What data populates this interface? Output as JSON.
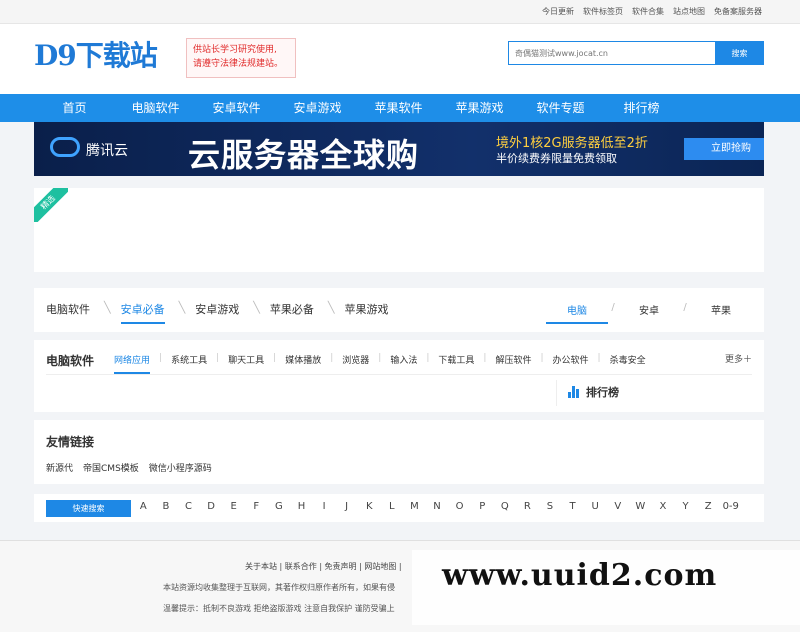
{
  "topbar": {
    "links": [
      "今日更新",
      "软件标签页",
      "软件合集",
      "站点地图",
      "免备案服务器"
    ]
  },
  "header": {
    "logo": "D9下载站",
    "notice_line1": "供站长学习研究使用,",
    "notice_line2": "请遵守法律法规建站。",
    "search_placeholder": "奇偶猫测试www.jocat.cn",
    "search_button": "搜索"
  },
  "nav": [
    "首页",
    "电脑软件",
    "安卓软件",
    "安卓游戏",
    "苹果软件",
    "苹果游戏",
    "软件专题",
    "排行榜"
  ],
  "banner": {
    "brand": "腾讯云",
    "headline": "云服务器全球购",
    "sub1": "境外1核2G服务器低至2折",
    "sub2": "半价续费券限量免费领取",
    "cta": "立即抢购"
  },
  "featured": {
    "ribbon": "精选"
  },
  "tabs": {
    "left": [
      "电脑软件",
      "安卓必备",
      "安卓游戏",
      "苹果必备",
      "苹果游戏"
    ],
    "active_left": "安卓必备",
    "right": [
      "电脑",
      "安卓",
      "苹果"
    ],
    "active_right": "电脑"
  },
  "software": {
    "title": "电脑软件",
    "categories": [
      "网络应用",
      "系统工具",
      "聊天工具",
      "媒体播放",
      "浏览器",
      "输入法",
      "下载工具",
      "解压软件",
      "办公软件",
      "杀毒安全"
    ],
    "active_category": "网络应用",
    "more": "更多＋",
    "rank_label": "排行榜"
  },
  "friends": {
    "title": "友情链接",
    "links": [
      "新源代",
      "帝国CMS模板",
      "微信小程序源码"
    ]
  },
  "alphabet": {
    "quick_search": "快速搜索",
    "letters": [
      "A",
      "B",
      "C",
      "D",
      "E",
      "F",
      "G",
      "H",
      "I",
      "J",
      "K",
      "L",
      "M",
      "N",
      "O",
      "P",
      "Q",
      "R",
      "S",
      "T",
      "U",
      "V",
      "W",
      "X",
      "Y",
      "Z",
      "0-9"
    ]
  },
  "footer": {
    "links": "关于本站 | 联系合作 | 免责声明 | 网站地图 |",
    "copyright": "本站资源均收集整理于互联网，其著作权归原作者所有，如果有侵",
    "tip": "温馨提示：抵制不良游戏 拒绝盗版游戏 注意自我保护 谨防受骗上"
  },
  "watermark": "www.uuid2.com",
  "colors": {
    "primary": "#1e88e5",
    "notice_red": "#e12b2b",
    "ribbon": "#1ec0a0"
  }
}
